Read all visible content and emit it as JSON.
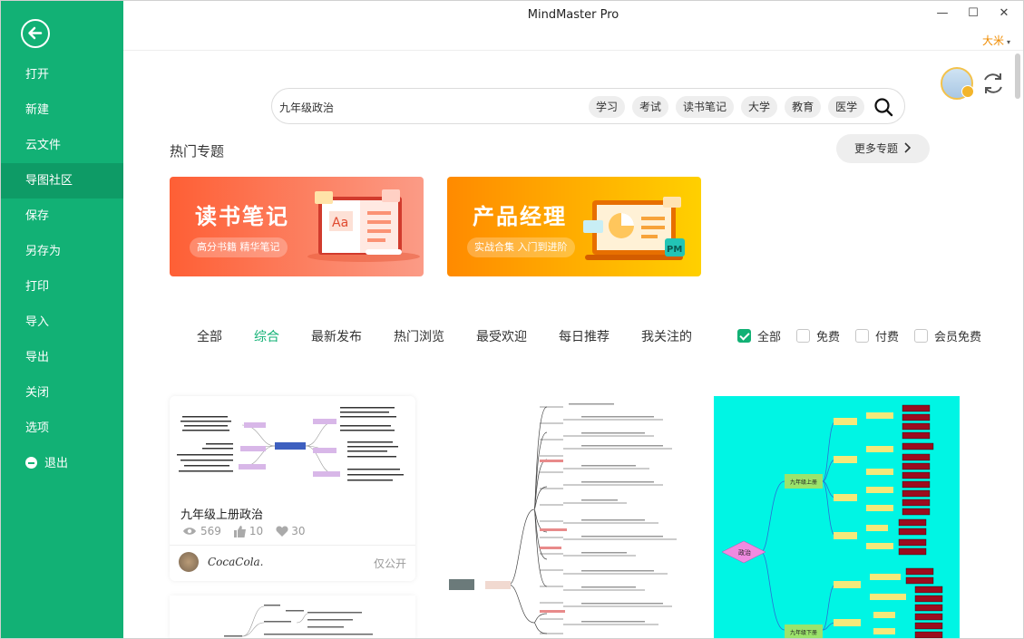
{
  "window": {
    "title": "MindMaster Pro",
    "user": "大米",
    "user_caret": "▾",
    "min": "—",
    "max": "☐",
    "close": "✕"
  },
  "sidebar": {
    "items": [
      {
        "label": "打开"
      },
      {
        "label": "新建"
      },
      {
        "label": "云文件"
      },
      {
        "label": "导图社区"
      },
      {
        "label": "保存"
      },
      {
        "label": "另存为"
      },
      {
        "label": "打印"
      },
      {
        "label": "导入"
      },
      {
        "label": "导出"
      },
      {
        "label": "关闭"
      },
      {
        "label": "选项"
      },
      {
        "label": "退出"
      }
    ],
    "active_index": 3,
    "accent": "#12b175"
  },
  "search": {
    "value": "九年级政治",
    "tags": [
      "学习",
      "考试",
      "读书笔记",
      "大学",
      "教育",
      "医学"
    ]
  },
  "hot": {
    "title": "热门专题",
    "more": "更多专题"
  },
  "banners": [
    {
      "title": "读书笔记",
      "subtitle": "高分书籍 精华笔记"
    },
    {
      "title": "产品经理",
      "subtitle": "实战合集 入门到进阶"
    }
  ],
  "tabs": [
    "全部",
    "综合",
    "最新发布",
    "热门浏览",
    "最受欢迎",
    "每日推荐",
    "我关注的"
  ],
  "active_tab": 1,
  "filters": [
    {
      "label": "全部",
      "checked": true
    },
    {
      "label": "免费",
      "checked": false
    },
    {
      "label": "付费",
      "checked": false
    },
    {
      "label": "会员免费",
      "checked": false
    }
  ],
  "cards": [
    {
      "title": "九年级上册政治",
      "views": "569",
      "likes": "10",
      "favorites": "30",
      "author": "CocaCola.",
      "visibility": "仅公开"
    }
  ],
  "card3_labels": {
    "center": "政治",
    "branch1": "九年级上册",
    "branch2": "九年级下册"
  }
}
